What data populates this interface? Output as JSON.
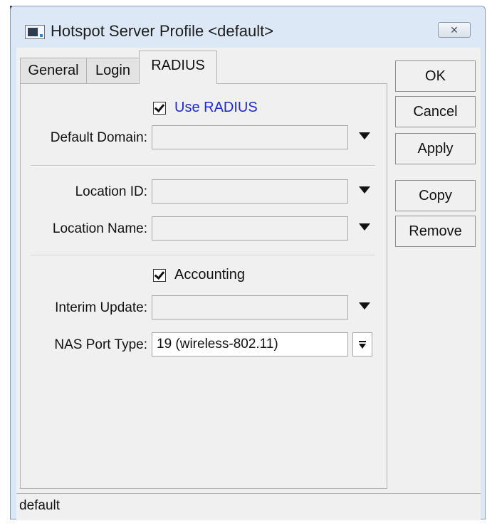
{
  "window": {
    "title": "Hotspot Server Profile <default>",
    "close_symbol": "✕"
  },
  "tabs": [
    {
      "label": "General",
      "active": false
    },
    {
      "label": "Login",
      "active": false
    },
    {
      "label": "RADIUS",
      "active": true
    }
  ],
  "radius": {
    "use_radius": {
      "label": "Use RADIUS",
      "checked": true,
      "color": "#1b2bd6"
    },
    "default_domain": {
      "label": "Default Domain:",
      "value": ""
    },
    "location_id": {
      "label": "Location ID:",
      "value": ""
    },
    "location_name": {
      "label": "Location Name:",
      "value": ""
    },
    "accounting": {
      "label": "Accounting",
      "checked": true
    },
    "interim_update": {
      "label": "Interim Update:",
      "value": ""
    },
    "nas_port_type": {
      "label": "NAS Port Type:",
      "value": "19 (wireless-802.11)"
    }
  },
  "buttons": {
    "ok": "OK",
    "cancel": "Cancel",
    "apply": "Apply",
    "copy": "Copy",
    "remove": "Remove"
  },
  "status": {
    "text": "default"
  }
}
